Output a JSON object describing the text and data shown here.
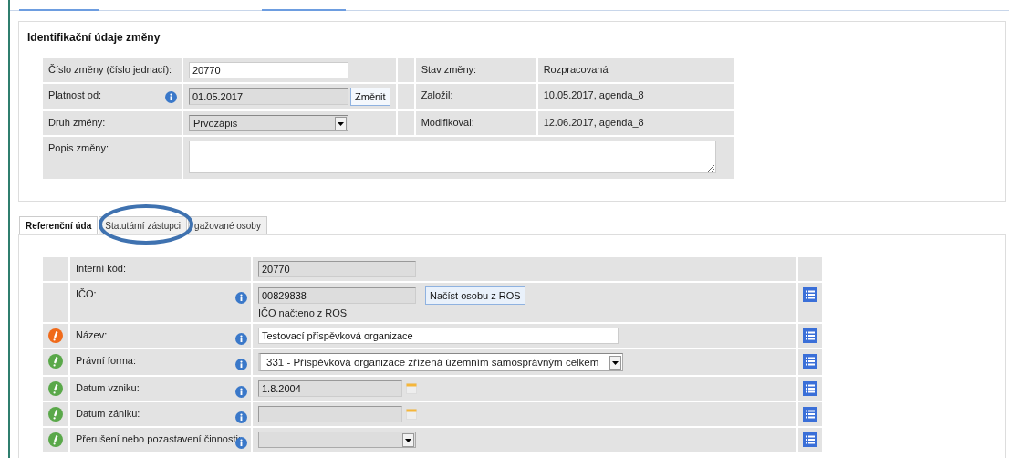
{
  "change_section": {
    "title": "Identifikační údaje změny",
    "rows": [
      {
        "label": "Číslo změny (číslo jednací):",
        "info": false,
        "field": {
          "kind": "input",
          "value": "20770"
        },
        "side_label": "Stav změny:",
        "side_value": "Rozpracovaná"
      },
      {
        "label": "Platnost od:",
        "info": true,
        "field": {
          "kind": "readonly",
          "value": "01.05.2017",
          "button": "Změnit"
        },
        "side_label": "Založil:",
        "side_value": "10.05.2017, agenda_8"
      },
      {
        "label": "Druh změny:",
        "info": false,
        "field": {
          "kind": "select",
          "value": "Prvozápis"
        },
        "side_label": "Modifikoval:",
        "side_value": "12.06.2017, agenda_8"
      },
      {
        "label": "Popis změny:",
        "info": false,
        "field": {
          "kind": "textarea"
        }
      }
    ]
  },
  "tabs": [
    {
      "label": "Referenční úda",
      "selected": true
    },
    {
      "label": "Statutární zástupci",
      "selected": false
    },
    {
      "label": "gažované osoby",
      "selected": false
    }
  ],
  "annotation": {
    "kind": "ellipse"
  },
  "detail_rows": [
    {
      "label": "Interní kód:",
      "info": false,
      "list_button": false,
      "field": {
        "kind": "readonly",
        "value": "20770"
      }
    },
    {
      "label": "IČO:",
      "info": true,
      "list_button": true,
      "field": {
        "kind": "readonly",
        "value": "00829838",
        "button": "Načíst osobu z ROS",
        "note": "IČO načteno z ROS"
      }
    },
    {
      "label": "Název:",
      "color": "#f06a1a",
      "info": true,
      "list_button": true,
      "field": {
        "kind": "input",
        "value": "Testovací příspěvková organizace"
      }
    },
    {
      "label": "Právní forma:",
      "color": "#5aa84a",
      "info": true,
      "list_button": true,
      "field": {
        "kind": "select",
        "value": "331 - Příspěvková organizace zřízená územním samosprávným celkem"
      }
    },
    {
      "label": "Datum vzniku:",
      "color": "#5aa84a",
      "info": true,
      "list_button": true,
      "field": {
        "kind": "date",
        "value": "1.8.2004"
      }
    },
    {
      "label": "Datum zániku:",
      "color": "#5aa84a",
      "info": true,
      "list_button": true,
      "field": {
        "kind": "date"
      }
    },
    {
      "label": "Přerušení nebo pozastavení činnosti:",
      "color": "#5aa84a",
      "info": true,
      "list_button": true,
      "field": {
        "kind": "select_empty"
      }
    }
  ]
}
